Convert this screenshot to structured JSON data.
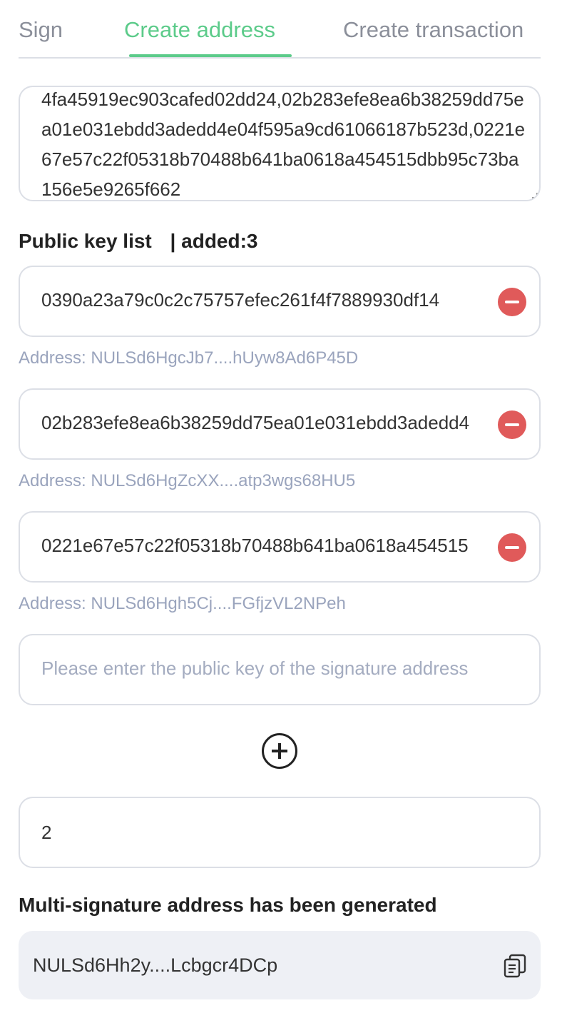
{
  "tabs": [
    {
      "label": "Sign"
    },
    {
      "label": "Create address"
    },
    {
      "label": "Create transaction"
    }
  ],
  "active_tab": "Create address",
  "pubkeys_textarea": {
    "value": "4fa45919ec903cafed02dd24,02b283efe8ea6b38259dd75ea01e031ebdd3adedd4e04f595a9cd61066187b523d,0221e67e57c22f05318b70488b641ba0618a454515dbb95c73ba156e5e9265f662"
  },
  "public_key_list": {
    "title": "Public key list",
    "count_label": "| added:3",
    "items": [
      {
        "key": "0390a23a79c0c2c75757efec261f4f7889930df14",
        "address": "Address: NULSd6HgcJb7....hUyw8Ad6P45D"
      },
      {
        "key": "02b283efe8ea6b38259dd75ea01e031ebdd3adedd4",
        "address": "Address: NULSd6HgZcXX....atp3wgs68HU5"
      },
      {
        "key": "0221e67e57c22f05318b70488b641ba0618a454515",
        "address": "Address: NULSd6Hgh5Cj....FGfjzVL2NPeh"
      }
    ],
    "new_key_placeholder": "Please enter the public key of the signature address"
  },
  "min_signatures": {
    "value": "2"
  },
  "result": {
    "title": "Multi-signature address has been generated",
    "address": "NULSd6Hh2y....Lcbgcr4DCp"
  },
  "icons": {
    "remove": "minus-circle-icon",
    "add": "plus-circle-icon",
    "copy": "copy-icon"
  },
  "colors": {
    "accent": "#5ccb8a",
    "danger": "#e05a5a",
    "muted": "#9aa4bd"
  }
}
